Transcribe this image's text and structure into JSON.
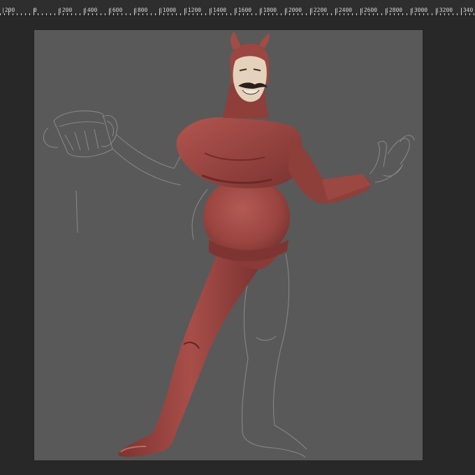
{
  "ruler": {
    "labels": [
      "|200",
      "0",
      "|200",
      "|400",
      "|600",
      "|800",
      "|1000",
      "|1200",
      "|1400",
      "|1600",
      "|1800",
      "|2000",
      "|2200",
      "|2400",
      "|2600",
      "|2800",
      "|3000",
      "|3200",
      "|340"
    ]
  },
  "canvas": {
    "background": "#595959",
    "artwork": "painted-devil-figure"
  },
  "colors": {
    "app_background": "#282828",
    "ruler_background": "#2e2e2e",
    "suit_red": "#9e4944",
    "suit_shadow": "#6d2c2a",
    "sketch_line": "#8b8b8b"
  }
}
